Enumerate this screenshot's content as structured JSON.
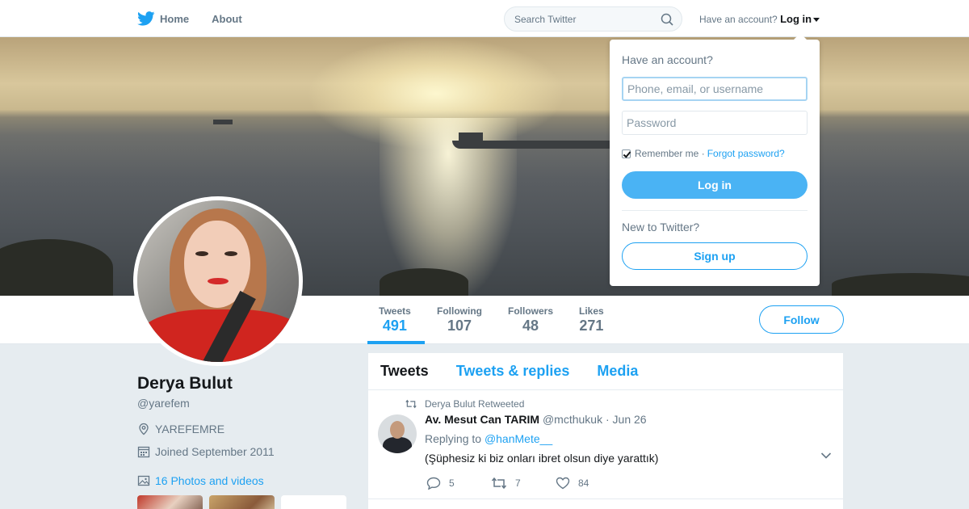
{
  "nav": {
    "home_label": "Home",
    "about_label": "About",
    "search_placeholder": "Search Twitter",
    "account_prompt": "Have an account?",
    "login_label": "Log in"
  },
  "colors": {
    "brand": "#1da1f2",
    "secondary_text": "#657786",
    "login_button": "#4ab3f4"
  },
  "icons": [
    "twitter-bird-icon",
    "search-icon",
    "location-icon",
    "calendar-icon",
    "photo-icon",
    "retweet-icon",
    "reply-icon",
    "like-icon",
    "chevron-down-icon"
  ],
  "stats": [
    {
      "label": "Tweets",
      "value": "491"
    },
    {
      "label": "Following",
      "value": "107"
    },
    {
      "label": "Followers",
      "value": "48"
    },
    {
      "label": "Likes",
      "value": "271"
    }
  ],
  "follow_label": "Follow",
  "profile": {
    "name": "Derya Bulut",
    "handle": "@yarefem",
    "location": "YAREFEMRE",
    "joined": "Joined September 2011",
    "photos": "16 Photos and videos"
  },
  "timeline": {
    "tabs": [
      "Tweets",
      "Tweets & replies",
      "Media"
    ],
    "tweet": {
      "retweeted_by": "Derya Bulut Retweeted",
      "fullname": "Av. Mesut Can TARIM",
      "username": "@mcthukuk",
      "time": "· Jun 26",
      "replying_prefix": "Replying to",
      "replying_to": "@hanMete__",
      "text": "(Şüphesiz ki biz onları ibret olsun diye yarattık)",
      "replies": "5",
      "retweets": "7",
      "likes": "84"
    }
  },
  "login_dropdown": {
    "title": "Have an account?",
    "username_placeholder": "Phone, email, or username",
    "password_placeholder": "Password",
    "remember_label": "Remember me ·",
    "forgot_label": "Forgot password?",
    "login_button": "Log in",
    "new_prompt": "New to Twitter?",
    "signup_button": "Sign up"
  }
}
